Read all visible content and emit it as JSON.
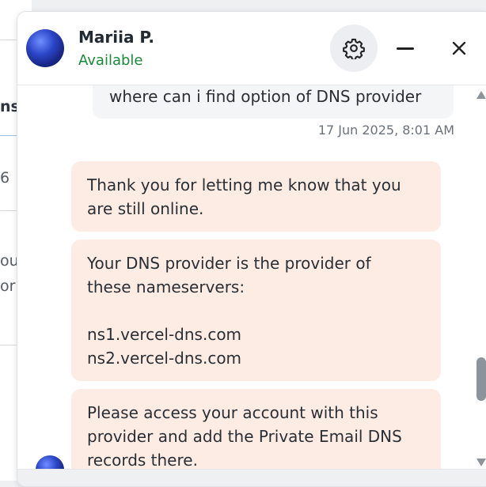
{
  "background_page": {
    "fragments": [
      "ns",
      "6",
      "ou",
      "or"
    ]
  },
  "chat": {
    "agent": {
      "name": "Mariia P.",
      "status": "Available"
    },
    "icons": {
      "settings": "gear-icon",
      "minimize": "minimize-icon",
      "close": "close-icon"
    },
    "messages": {
      "user": {
        "text": "where can i find option of DNS provider",
        "timestamp": "17 Jun 2025, 8:01 AM"
      },
      "agent": [
        {
          "lines": [
            "Thank you for letting me know that you",
            "are still online."
          ]
        },
        {
          "lines": [
            "Your DNS provider is the provider of",
            "these nameservers:",
            "",
            "ns1.vercel-dns.com",
            "ns2.vercel-dns.com"
          ]
        },
        {
          "lines": [
            "Please access your account with this",
            "provider and add the Private Email DNS",
            "records there."
          ]
        }
      ]
    },
    "colors": {
      "status_green": "#1a8a3a",
      "agent_bubble": "#fdece3",
      "user_bubble": "#f4f5f7"
    }
  }
}
